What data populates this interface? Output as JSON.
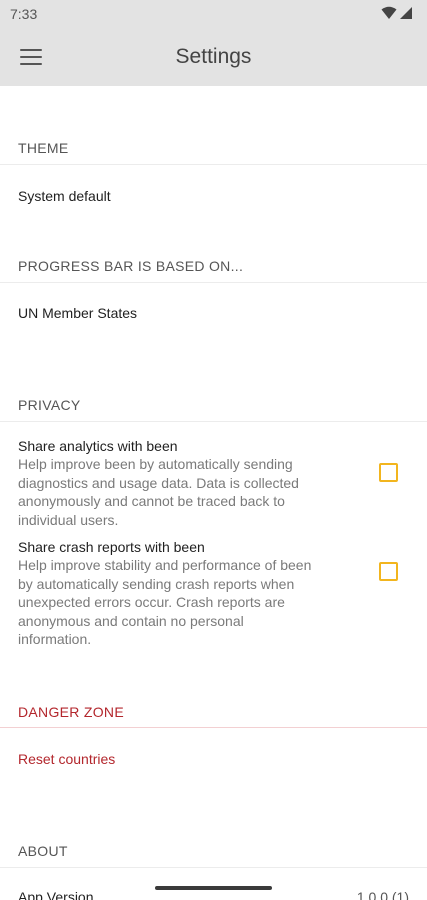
{
  "status_bar": {
    "time": "7:33",
    "icons": [
      "wifi-icon",
      "cell-signal-icon"
    ]
  },
  "app_bar": {
    "title": "Settings",
    "menu_icon": "hamburger-menu-icon"
  },
  "sections": {
    "theme": {
      "header": "THEME",
      "value": "System default"
    },
    "progress": {
      "header": "PROGRESS BAR IS BASED ON...",
      "value": "UN Member States"
    },
    "privacy": {
      "header": "PRIVACY",
      "analytics": {
        "title": "Share analytics with been",
        "summary_lines": [
          "Help improve been by automatically sending",
          "diagnostics and usage data. Data is collected",
          "anonymously and cannot be traced back to",
          "individual users."
        ],
        "checked": false
      },
      "crash": {
        "title": "Share crash reports with been",
        "summary_lines": [
          "Help improve stability and performance of been",
          "by automatically sending crash reports when",
          "unexpected errors occur. Crash reports are",
          "anonymous and contain no personal",
          "information."
        ],
        "checked": false
      }
    },
    "danger": {
      "header": "DANGER ZONE",
      "reset_label": "Reset countries"
    },
    "about": {
      "header": "ABOUT",
      "version_label": "App Version",
      "version_value": "1.0.0 (1)"
    }
  },
  "colors": {
    "accent_checkbox": "#f2b51e",
    "danger": "#b3262c",
    "app_bar_bg": "#e3e3e3"
  }
}
